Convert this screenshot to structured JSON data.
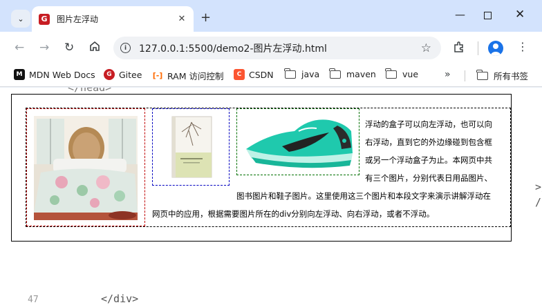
{
  "browser": {
    "tab_title": "图片左浮动",
    "favicon_letter": "G",
    "url": "127.0.0.1:5500/demo2-图片左浮动.html",
    "bookmarks": [
      {
        "label": "MDN Web Docs",
        "icon": "mdn-icon"
      },
      {
        "label": "Gitee",
        "icon": "gitee-icon"
      },
      {
        "label": "RAM 访问控制",
        "icon": "aliyun-icon"
      },
      {
        "label": "CSDN",
        "icon": "csdn-icon"
      },
      {
        "label": "java",
        "icon": "folder-icon"
      },
      {
        "label": "maven",
        "icon": "folder-icon"
      },
      {
        "label": "vue",
        "icon": "folder-icon"
      }
    ],
    "all_bookmarks_label": "所有书签",
    "accent_color": "#d3e3fd"
  },
  "page": {
    "background_code": {
      "top_line": "</head>",
      "line_number": "47",
      "bottom_line": "</div>",
      "right_glyphs": ">/ /"
    },
    "paragraph_lines": [
      "浮动的盒子可以向左浮动，也可以向",
      "右浮动，直到它的外边缘碰到包含框",
      "或另一个浮动盒子为止。本网页中共",
      "有三个图片，分别代表日用品图片、",
      "图书图片和鞋子图片。这里使用这三个图片和本段文字来演示讲解浮动在",
      "网页中的应用，根据需要图片所在的div分别向左浮动、向右浮动，或者不浮动。"
    ],
    "images": [
      {
        "name": "bedroom-photo",
        "desc": "bed"
      },
      {
        "name": "book-cover",
        "desc": "book"
      },
      {
        "name": "sneaker-photo",
        "desc": "shoe"
      }
    ]
  }
}
